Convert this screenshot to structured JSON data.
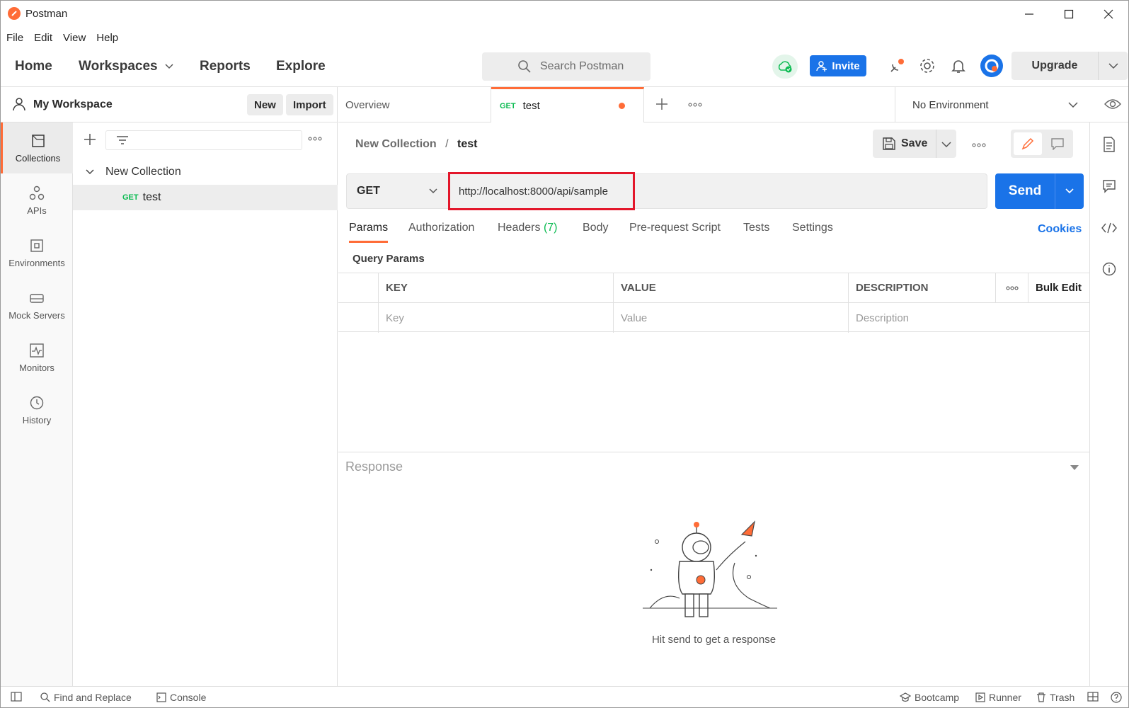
{
  "app": {
    "title": "Postman"
  },
  "menu": [
    "File",
    "Edit",
    "View",
    "Help"
  ],
  "nav": {
    "home": "Home",
    "workspaces": "Workspaces",
    "reports": "Reports",
    "explore": "Explore"
  },
  "search": {
    "placeholder": "Search Postman"
  },
  "header": {
    "invite": "Invite",
    "upgrade": "Upgrade"
  },
  "workspace": {
    "name": "My Workspace",
    "new_label": "New",
    "import_label": "Import"
  },
  "rail": [
    {
      "label": "Collections",
      "icon": "collections-icon"
    },
    {
      "label": "APIs",
      "icon": "apis-icon"
    },
    {
      "label": "Environments",
      "icon": "environments-icon"
    },
    {
      "label": "Mock Servers",
      "icon": "mock-servers-icon"
    },
    {
      "label": "Monitors",
      "icon": "monitors-icon"
    },
    {
      "label": "History",
      "icon": "history-icon"
    }
  ],
  "sidebar": {
    "collection": "New Collection",
    "request_method": "GET",
    "request_name": "test"
  },
  "tabs": {
    "overview": "Overview",
    "test_method": "GET",
    "test_name": "test"
  },
  "environment": {
    "selected": "No Environment"
  },
  "request": {
    "breadcrumb_collection": "New Collection",
    "breadcrumb_sep": "/",
    "breadcrumb_request": "test",
    "save": "Save",
    "method": "GET",
    "url": "http://localhost:8000/api/sample",
    "send": "Send"
  },
  "req_tabs": {
    "params": "Params",
    "authorization": "Authorization",
    "headers": "Headers",
    "headers_count": "(7)",
    "body": "Body",
    "prerequest": "Pre-request Script",
    "tests": "Tests",
    "settings": "Settings",
    "cookies": "Cookies"
  },
  "params": {
    "title": "Query Params",
    "col_key": "KEY",
    "col_value": "VALUE",
    "col_description": "DESCRIPTION",
    "bulk_edit": "Bulk Edit",
    "ph_key": "Key",
    "ph_value": "Value",
    "ph_description": "Description"
  },
  "response": {
    "label": "Response",
    "hint": "Hit send to get a response"
  },
  "status": {
    "find_replace": "Find and Replace",
    "console": "Console",
    "bootcamp": "Bootcamp",
    "runner": "Runner",
    "trash": "Trash"
  },
  "colors": {
    "accent": "#ff6c37",
    "primary": "#1a73e8",
    "get": "#0cbb52",
    "highlight": "#e3162a"
  }
}
